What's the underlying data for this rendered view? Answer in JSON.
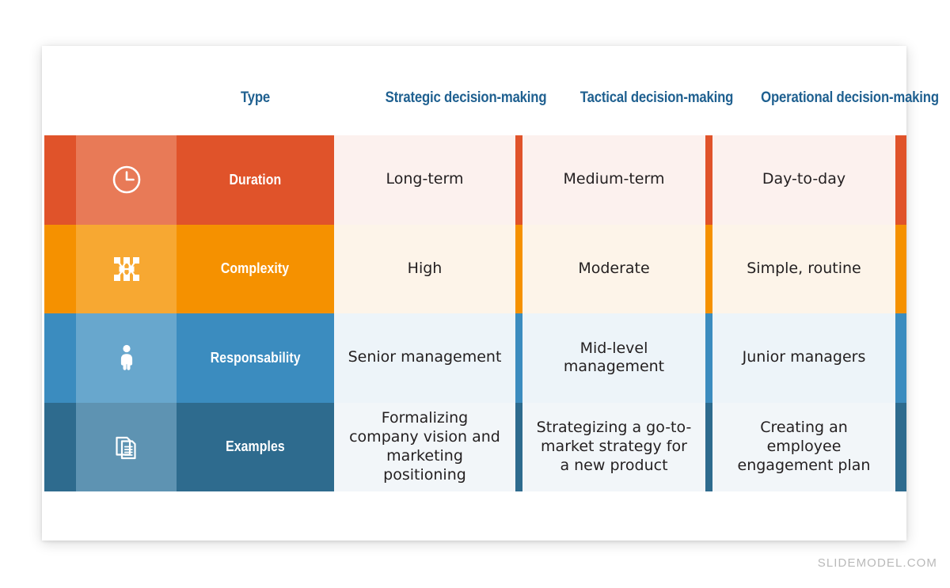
{
  "footer": {
    "brand": "SLIDEMODEL.COM"
  },
  "table": {
    "headers": [
      {
        "label": "Type",
        "name": "type"
      },
      {
        "label": "Strategic decision-making",
        "name": "strategic"
      },
      {
        "label": "Tactical decision-making",
        "name": "tactical"
      },
      {
        "label": "Operational decision-making",
        "name": "operational"
      }
    ],
    "header_color": "#1f6090",
    "rows": [
      {
        "label": "Duration",
        "icon": "clock-icon",
        "colors": {
          "stripe": "#e0532a",
          "icon_cell": "#e87a57",
          "label_cell": "#e0532a",
          "separator": "#e0532a",
          "content_bg": "#fcf1ee",
          "right_stripe": "#e0532a"
        },
        "cells": [
          "Long-term",
          "Medium-term",
          "Day-to-day"
        ]
      },
      {
        "label": "Complexity",
        "icon": "network-nodes-icon",
        "colors": {
          "stripe": "#f59100",
          "icon_cell": "#f7a832",
          "label_cell": "#f59100",
          "separator": "#f59100",
          "content_bg": "#fdf4e9",
          "right_stripe": "#f59100"
        },
        "cells": [
          "High",
          "Moderate",
          "Simple, routine"
        ]
      },
      {
        "label": "Responsability",
        "icon": "person-icon",
        "colors": {
          "stripe": "#3b8cbf",
          "icon_cell": "#68a7cd",
          "label_cell": "#3b8cbf",
          "separator": "#3b8cbf",
          "content_bg": "#edf4f9",
          "right_stripe": "#3b8cbf"
        },
        "cells": [
          "Senior management",
          "Mid-level management",
          "Junior managers"
        ]
      },
      {
        "label": "Examples",
        "icon": "documents-icon",
        "colors": {
          "stripe": "#2e6b8e",
          "icon_cell": "#5e93b2",
          "label_cell": "#2e6b8e",
          "separator": "#2e6b8e",
          "content_bg": "#f2f6f9",
          "right_stripe": "#2e6b8e"
        },
        "cells": [
          "Formalizing company vision and marketing positioning",
          "Strategizing a go-to-market strategy for a new product",
          "Creating an employee engagement plan"
        ]
      }
    ]
  }
}
